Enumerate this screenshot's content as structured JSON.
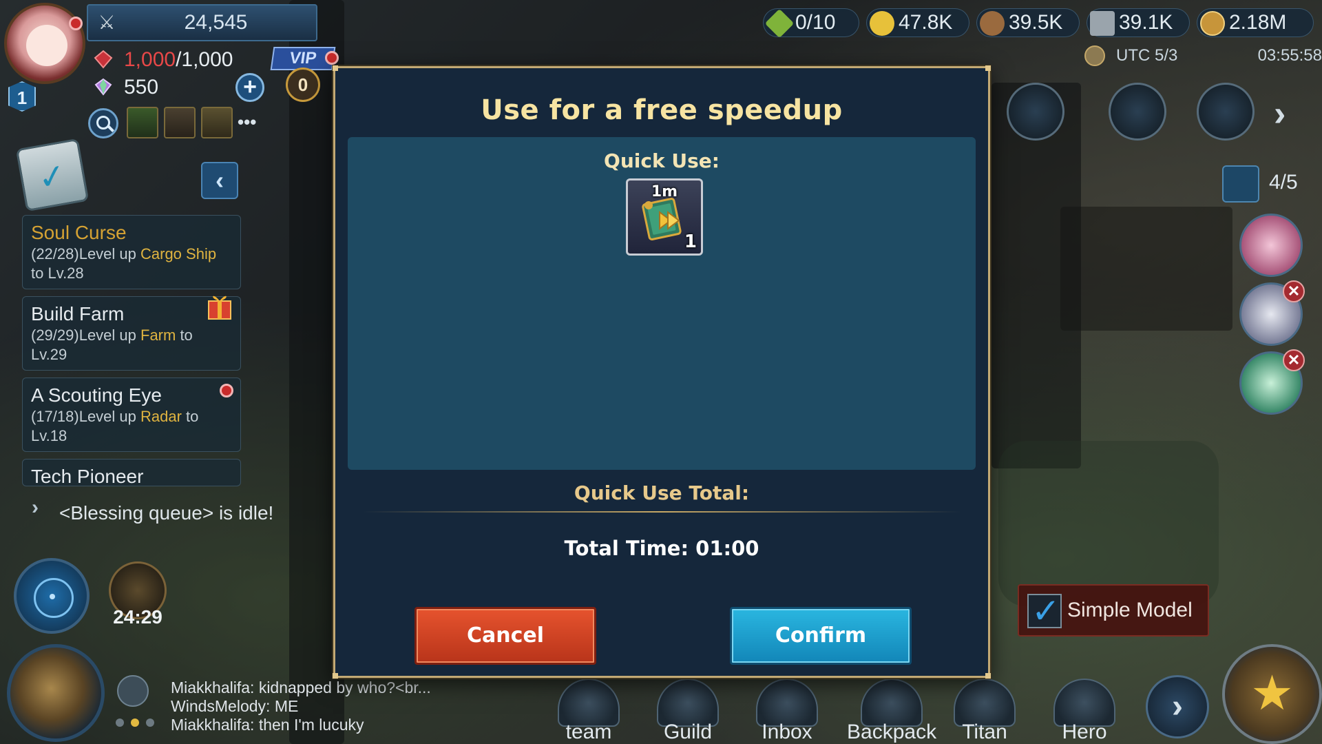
{
  "player": {
    "level": "1",
    "power": "24,545",
    "stamina_current": "1,000",
    "stamina_max": "/1,000",
    "gems": "550",
    "vip_label": "VIP",
    "vip_level": "0"
  },
  "quests": [
    {
      "title": "Soul Curse",
      "desc_prefix": "(22/28)Level up ",
      "highlight": "Cargo Ship",
      "desc_suffix": " to Lv.28",
      "title_color": "gold"
    },
    {
      "title": "Build Farm",
      "desc_prefix": "(29/29)Level up ",
      "highlight": "Farm",
      "desc_suffix": " to Lv.29",
      "title_color": "white"
    },
    {
      "title": "A Scouting Eye",
      "desc_prefix": "(17/18)Level up ",
      "highlight": "Radar",
      "desc_suffix": " to Lv.18",
      "title_color": "white"
    },
    {
      "title": "Tech Pioneer"
    }
  ],
  "idle_notice": "<Blessing queue> is idle!",
  "gift_timer": "24:29",
  "chat": [
    "Miakkhalifa: kidnapped by who?<br...",
    "WindsMelody: ME",
    "Miakkhalifa: then I'm lucuky"
  ],
  "resources": {
    "energy": "0/10",
    "food": "47.8K",
    "wood": "39.5K",
    "stone": "39.1K",
    "gold": "2.18M"
  },
  "utc_date": "UTC 5/3",
  "utc_time": "03:55:58",
  "squad_count": "4/5",
  "simple_model_label": "Simple Model",
  "nav": [
    {
      "label": "team"
    },
    {
      "label": "Guild"
    },
    {
      "label": "Inbox"
    },
    {
      "label": "Backpack"
    },
    {
      "label": "Titan"
    },
    {
      "label": "Hero"
    }
  ],
  "modal": {
    "title": "Use for a free speedup",
    "quick_use_label": "Quick Use:",
    "item": {
      "duration": "1m",
      "count": "1",
      "icon": "speedup-scroll-icon"
    },
    "total_label": "Quick Use Total:",
    "total_time": "Total Time: 01:00",
    "cancel_label": "Cancel",
    "confirm_label": "Confirm"
  },
  "colors": {
    "modal_bg": "#15273b",
    "modal_border": "#c3a974",
    "panel_bg": "#1e4a62",
    "title_gold": "#f7e4a2",
    "cancel_red": "#d0431f",
    "confirm_blue": "#1ea0cc"
  }
}
